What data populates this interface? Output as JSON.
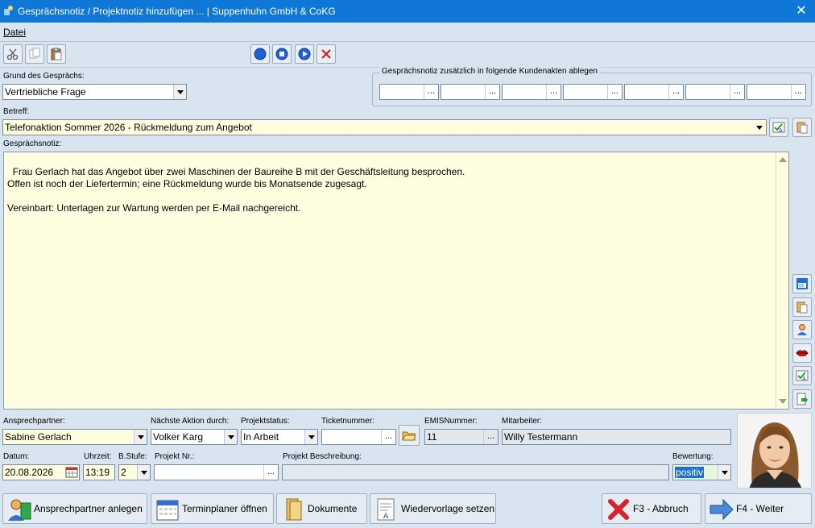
{
  "window": {
    "title": "Gesprächsnotiz / Projektnotiz hinzufügen ... | Suppenhuhn GmbH & CoKG",
    "close_symbol": "✕"
  },
  "menu": {
    "datei": "Datei"
  },
  "grund": {
    "label": "Grund des Gesprächs:",
    "value": "Vertriebliche Frage"
  },
  "kundenakten": {
    "legend": "Gesprächsnotiz zusätzlich in folgende Kundenakten ablegen",
    "dots": "..."
  },
  "betreff": {
    "label": "Betreff:",
    "value": "Telefonaktion Sommer 2026 - Rückmeldung zum Angebot"
  },
  "notiz": {
    "label": "Gesprächsnotiz:",
    "text": "Frau Gerlach hat das Angebot über zwei Maschinen der Baureihe B mit der Geschäftsleitung besprochen.\nOffen ist noch der Liefertermin; eine Rückmeldung wurde bis Monatsende zugesagt.\n\nVereinbart: Unterlagen zur Wartung werden per E-Mail nachgereicht."
  },
  "ansprechpartner": {
    "label": "Ansprechpartner:",
    "value": "Sabine Gerlach"
  },
  "naechste_aktion": {
    "label": "Nächste Aktion durch:",
    "value": "Volker Karg"
  },
  "projektstatus": {
    "label": "Projektstatus:",
    "value": "In Arbeit"
  },
  "ticketnummer": {
    "label": "Ticketnummer:",
    "value": "",
    "dots": "..."
  },
  "emis": {
    "label": "EMISNummer:",
    "value": "11",
    "dots": "..."
  },
  "mitarbeiter": {
    "label": "Mitarbeiter:",
    "value": "Willy Testermann"
  },
  "datum": {
    "label": "Datum:",
    "value": "20.08.2026"
  },
  "uhrzeit": {
    "label": "Uhrzeit:",
    "value": "13:19"
  },
  "bstufe": {
    "label": "B.Stufe:",
    "value": "2"
  },
  "projekt_nr": {
    "label": "Projekt Nr.:",
    "value": "",
    "dots": "..."
  },
  "projekt_beschreibung": {
    "label": "Projekt Beschreibung:",
    "value": ""
  },
  "bewertung": {
    "label": "Bewertung:",
    "value": "positiv"
  },
  "buttons": {
    "ansprechpartner_anlegen": "Ansprechpartner anlegen",
    "terminplaner": "Terminplaner öffnen",
    "dokumente": "Dokumente",
    "wiedervorlage": "Wiedervorlage setzen",
    "abbruch": "F3 - Abbruch",
    "weiter": "F4 - Weiter"
  },
  "colors": {
    "titlebar": "#0f78d7",
    "background": "#d8e4f0",
    "field_yellow": "#fffde0",
    "cancel_red": "#d9232a",
    "next_blue": "#2d6fc0"
  }
}
